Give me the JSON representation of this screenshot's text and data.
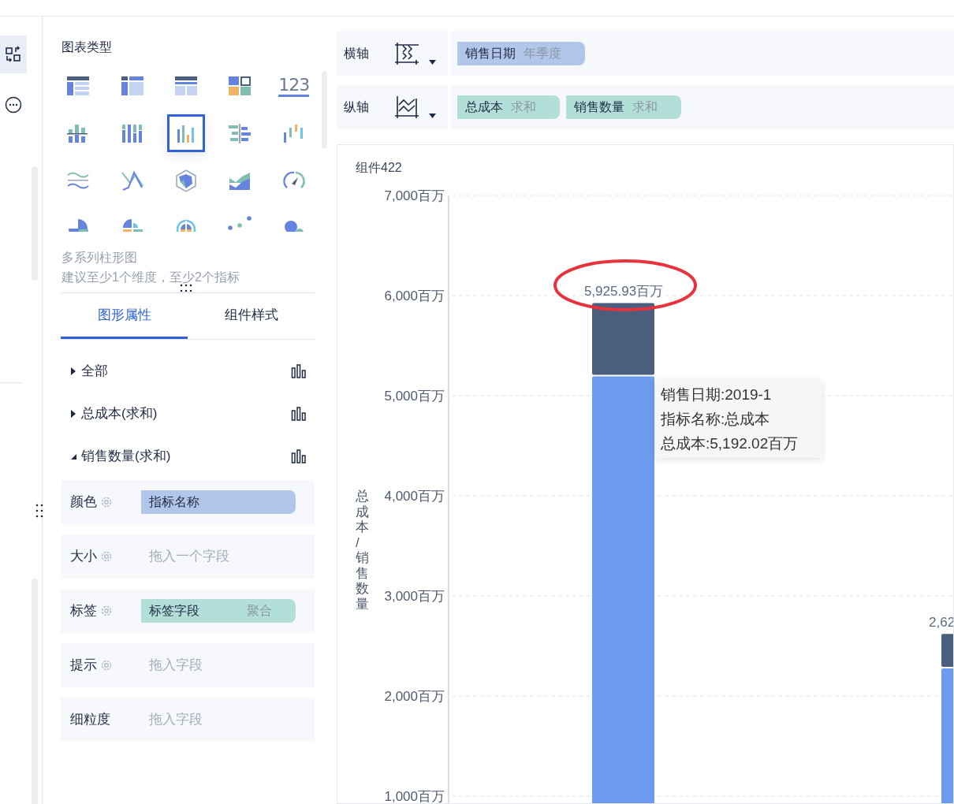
{
  "left_rail": {
    "icons": [
      {
        "kind": "swap",
        "selected": true
      },
      {
        "kind": "more",
        "selected": false
      }
    ]
  },
  "chart_type_panel": {
    "title": "图表类型",
    "types": [
      {
        "kind": "table",
        "selected": false
      },
      {
        "kind": "pivot",
        "selected": false
      },
      {
        "kind": "detail",
        "selected": false
      },
      {
        "kind": "mosaic",
        "selected": false
      },
      {
        "kind": "number",
        "text": "123",
        "selected": false
      },
      {
        "kind": "stacked",
        "selected": false
      },
      {
        "kind": "grouped",
        "selected": false
      },
      {
        "kind": "columns",
        "selected": true
      },
      {
        "kind": "bidirectional",
        "selected": false
      },
      {
        "kind": "waterfall",
        "selected": false
      },
      {
        "kind": "range",
        "selected": false
      },
      {
        "kind": "crossline",
        "selected": false
      },
      {
        "kind": "radar",
        "selected": false
      },
      {
        "kind": "area",
        "selected": false
      },
      {
        "kind": "gauge",
        "selected": false
      },
      {
        "kind": "pie",
        "selected": false
      },
      {
        "kind": "rose",
        "selected": false
      },
      {
        "kind": "sunburst",
        "selected": false
      },
      {
        "kind": "scatter",
        "selected": false
      },
      {
        "kind": "bubble",
        "selected": false
      }
    ],
    "description": "多系列柱形图",
    "hint": "建议至少1个维度，至少2个指标"
  },
  "property_tabs": [
    {
      "label": "图形属性",
      "selected": true
    },
    {
      "label": "组件样式",
      "selected": false
    }
  ],
  "series_tree": [
    {
      "label": "全部",
      "expanded": false
    },
    {
      "label": "总成本(求和)",
      "expanded": false
    },
    {
      "label": "销售数量(求和)",
      "expanded": true
    }
  ],
  "encodings": [
    {
      "label": "颜色",
      "settings": true,
      "field": {
        "kind": "dimension",
        "name": "指标名称"
      }
    },
    {
      "label": "大小",
      "settings": true,
      "placeholder": "拖入一个字段"
    },
    {
      "label": "标签",
      "settings": true,
      "field": {
        "kind": "measure",
        "name": "标签字段",
        "aggregation": "聚合"
      }
    },
    {
      "label": "提示",
      "settings": true,
      "placeholder": "拖入字段"
    },
    {
      "label": "细粒度",
      "settings": false,
      "placeholder": "拖入字段"
    }
  ],
  "shelves": [
    {
      "label": "横轴",
      "kind": "horizontal",
      "fields": [
        {
          "kind": "dimension",
          "name": "销售日期",
          "modifier": "年季度"
        }
      ]
    },
    {
      "label": "纵轴",
      "kind": "vertical",
      "fields": [
        {
          "kind": "measure",
          "name": "总成本",
          "modifier": "求和"
        },
        {
          "kind": "measure",
          "name": "销售数量",
          "modifier": "求和"
        }
      ]
    }
  ],
  "chart": {
    "title": "组件422",
    "chart_data": {
      "type": "bar",
      "stacked": true,
      "grid": true,
      "ylabel": "总成本/销售数量",
      "ylim": [
        0,
        7000
      ],
      "yticks": [
        {
          "value": 7000,
          "label": "7,000百万"
        },
        {
          "value": 6000,
          "label": "6,000百万"
        },
        {
          "value": 5000,
          "label": "5,000百万"
        },
        {
          "value": 4000,
          "label": "4,000百万"
        },
        {
          "value": 3000,
          "label": "3,000百万"
        },
        {
          "value": 2000,
          "label": "2,000百万"
        },
        {
          "value": 1000,
          "label": "1,000百万"
        }
      ],
      "series": [
        {
          "color": "#6d9bef",
          "values": [
            5192,
            2276
          ]
        },
        {
          "color": "#4b5e7e",
          "values": [
            734,
            344
          ]
        }
      ]
    },
    "total_labels": [
      "5,925.93百万",
      "2,62"
    ],
    "tooltip": [
      "销售日期:2019-1",
      "指标名称:总成本",
      "总成本:5,192.02百万"
    ]
  }
}
